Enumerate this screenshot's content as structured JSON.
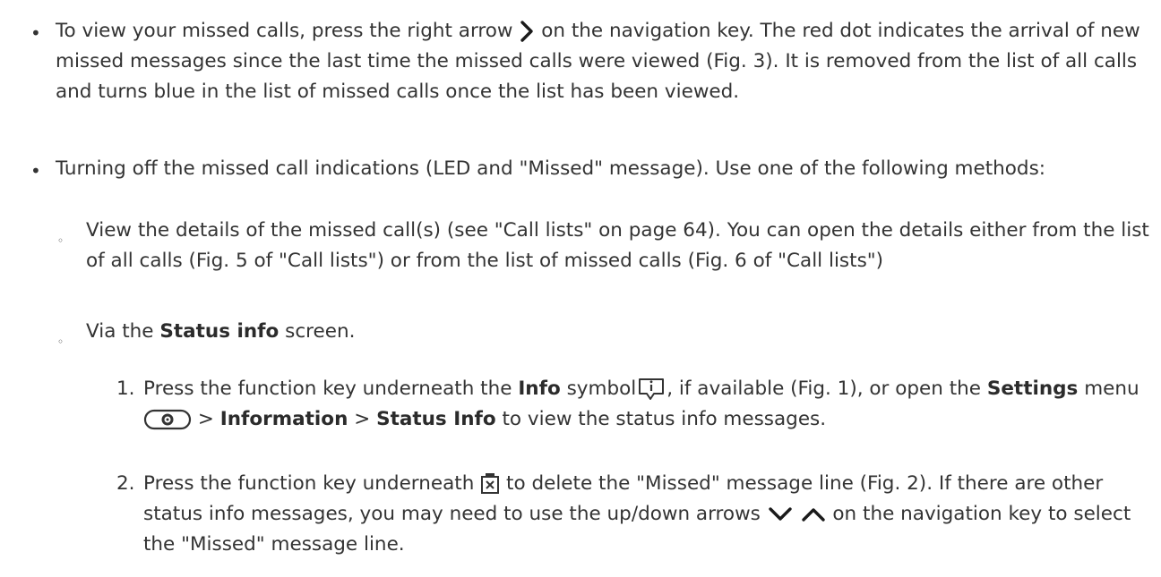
{
  "bullet1": {
    "marker": "•",
    "part1": "To view your missed calls, press the right arrow",
    "part2": "on the navigation key.  The red dot indicates the arrival of new missed messages since the last time the missed calls were viewed (Fig. 3).  It is removed from the list of all calls and turns blue in the list of missed calls once the list has been viewed.",
    "icon": "right-arrow-icon"
  },
  "bullet2": {
    "marker": "•",
    "text": "Turning off the missed call indications (LED and \"Missed\" message).  Use one of the following methods:"
  },
  "sub1": {
    "marker": "◦",
    "text": "View the details of the missed call(s) (see \"Call lists\" on page 64).  You can open the details either from the list of all calls (Fig. 5 of \"Call lists\") or from the list of missed calls (Fig. 6 of \"Call lists\")"
  },
  "sub2": {
    "marker": "◦",
    "prefix": "Via the",
    "bold": "Status info",
    "suffix": "screen."
  },
  "step1": {
    "number": "1.",
    "t1": "Press the function key underneath the",
    "b1": "Info",
    "t2": "symbol",
    "t3": ", if available (Fig. 1), or open the",
    "b2": "Settings",
    "t4": "menu",
    "sep1": ">",
    "b3": "Information",
    "sep2": ">",
    "b4": "Status Info",
    "t5": "to view the status info messages.",
    "icons": [
      "info-icon",
      "settings-icon"
    ]
  },
  "step2": {
    "number": "2.",
    "t1": "Press the function key underneath",
    "t2": "to delete the \"Missed\" message line (Fig. 2).  If there are other status info messages, you may need to use the up/down arrows",
    "t3": "on the navigation key to select the \"Missed\" message line.",
    "icons": [
      "delete-icon",
      "down-arrow-icon",
      "up-arrow-icon"
    ]
  }
}
